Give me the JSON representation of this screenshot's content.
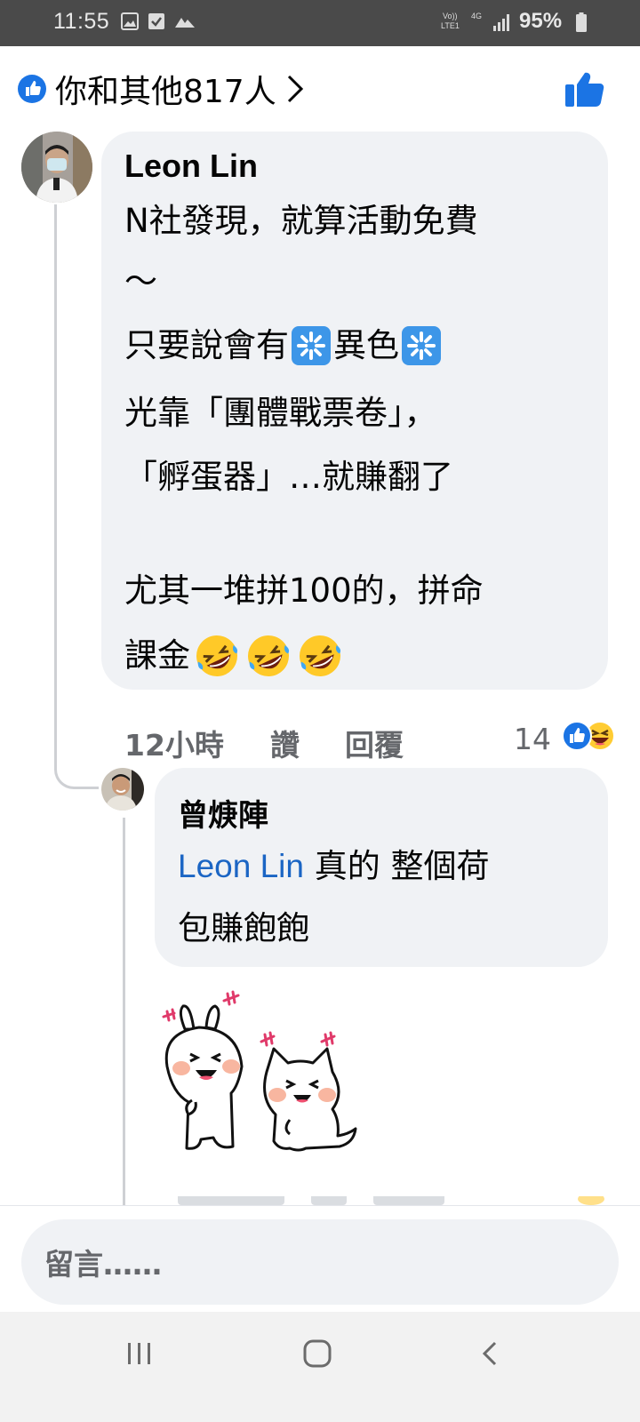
{
  "status_bar": {
    "time": "11:55",
    "battery": "95%",
    "volte_label": "Vo))",
    "lte_label": "LTE1",
    "network_label": "4G"
  },
  "likes_header": {
    "text": "你和其他817人",
    "accent": "#1b74e4"
  },
  "comments": [
    {
      "author": "Leon Lin",
      "lines": [
        "N社發現，就算活動免費",
        "～",
        "只要說會有",
        "光靠「團體戰票卷」，",
        "「孵蛋器」…就賺翻了",
        "",
        "尤其一堆拼100的，拼命",
        "課金"
      ],
      "inline_emoji_after_line_3": [
        "sparkle-emoji",
        "sparkle-emoji"
      ],
      "middle_text_line_3": "異色",
      "trailing_emoji_line_8": [
        "rolling-laughing-emoji",
        "rolling-laughing-emoji",
        "rolling-laughing-emoji"
      ],
      "time": "12小時",
      "like_label": "讚",
      "reply_label": "回覆",
      "reaction_count": "14",
      "reactions": [
        "like-reaction-icon",
        "haha-reaction-icon"
      ]
    },
    {
      "author": "曾焿陣",
      "mention": "Leon Lin",
      "line1_rest": " 真的 整個荷",
      "line2": "包賺飽飽",
      "sticker": "rabbit-and-cat-laughing-sticker"
    }
  ],
  "composer": {
    "placeholder": "留言……"
  },
  "nav": {
    "recents": "recents-icon",
    "home": "home-icon",
    "back": "back-icon"
  }
}
